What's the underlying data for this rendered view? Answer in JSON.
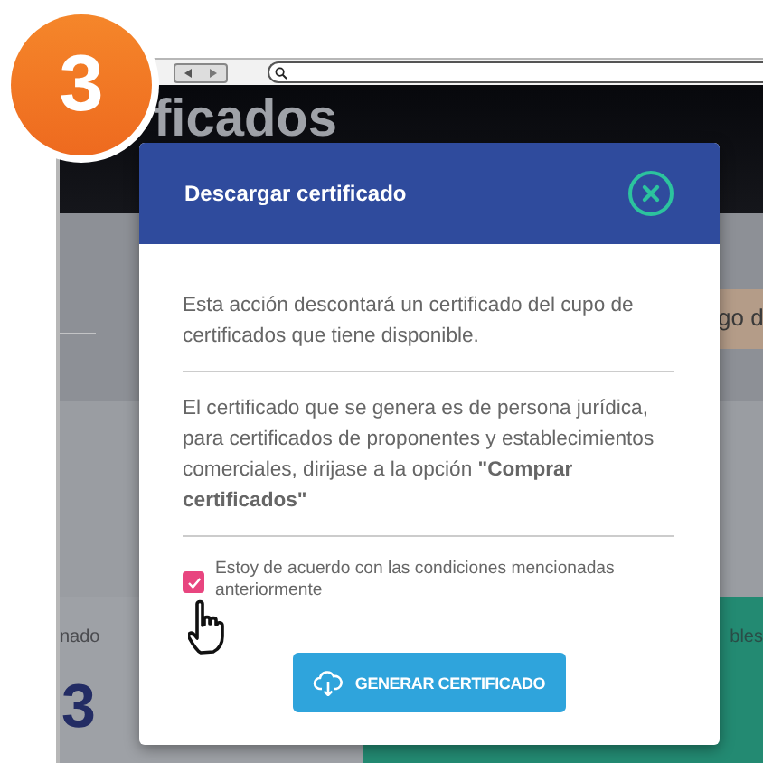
{
  "badge": {
    "text": "3"
  },
  "page": {
    "heading": "ficados",
    "side_text": "go d",
    "row_label_left": "nado",
    "row_label_right": "bles",
    "big_number": "3"
  },
  "modal": {
    "title": "Descargar certificado",
    "paragraphs": [
      "Esta acción descontará un certificado del cupo de certificados que tiene disponible.",
      "El certificado que se genera es de persona jurídica, para certificados de proponentes y establecimientos comerciales, dirijase a la opción **\"Comprar certificados\"**"
    ],
    "checkbox": {
      "label": "Estoy de acuerdo con las condiciones mencionadas anteriormente",
      "checked": true
    },
    "button": "GENERAR CERTIFICADO"
  }
}
